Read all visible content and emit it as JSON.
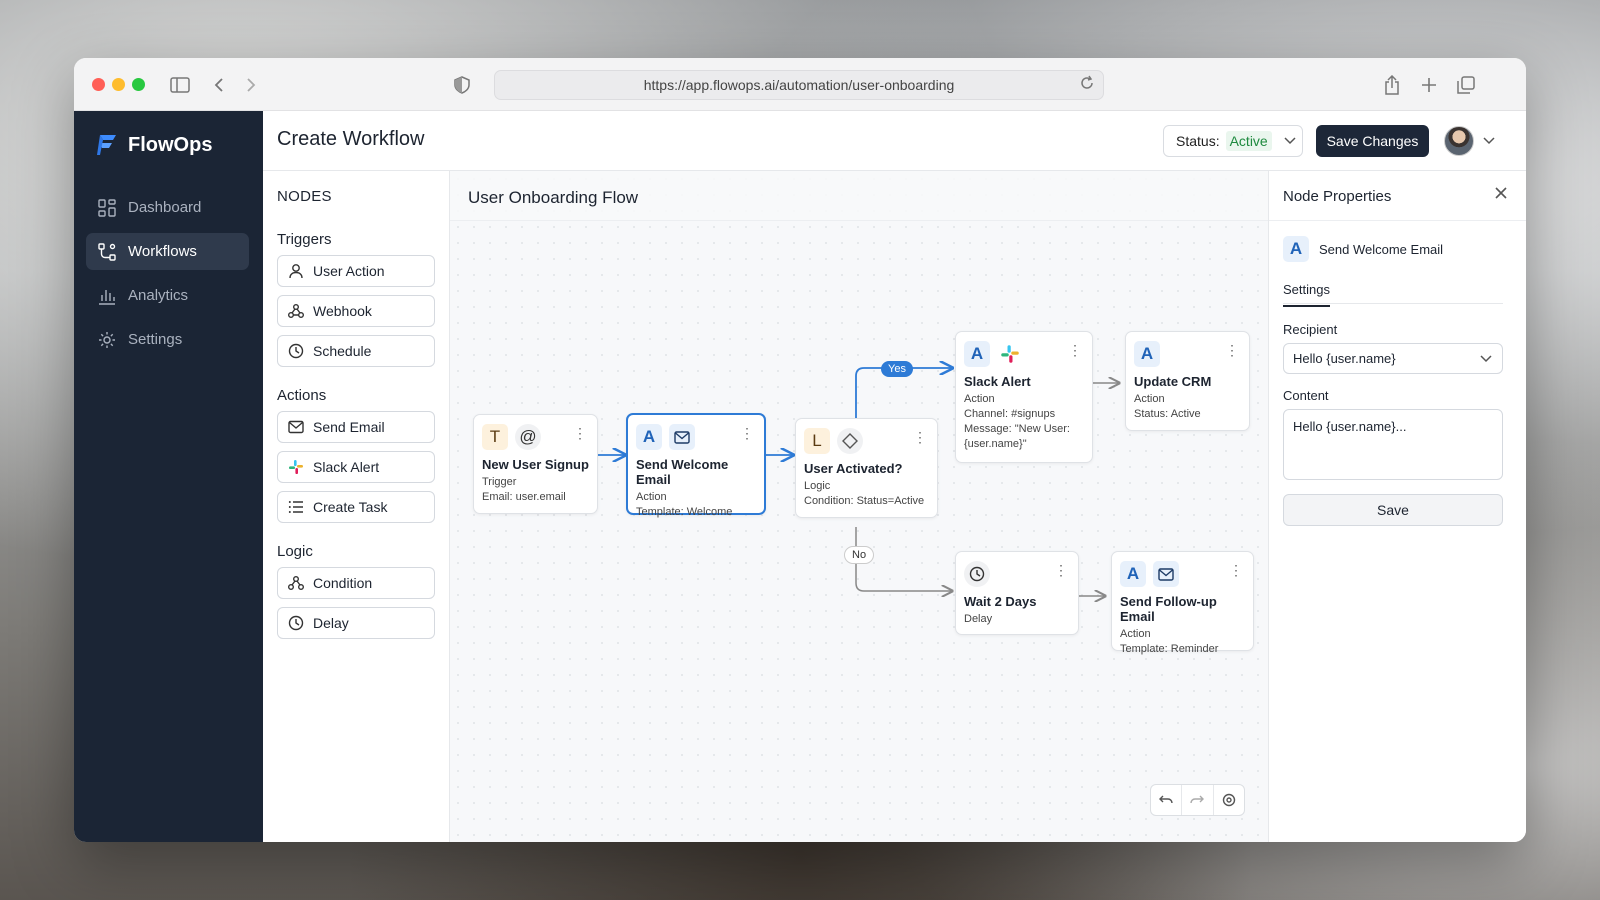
{
  "browser": {
    "url": "https://app.flowops.ai/automation/user-onboarding",
    "traffic_lights": [
      "#ff5f57",
      "#febc2e",
      "#28c840"
    ]
  },
  "brand": {
    "name": "FlowOps",
    "color": "#3d8bfd"
  },
  "sidebar": {
    "items": [
      {
        "label": "Dashboard",
        "icon": "grid-icon"
      },
      {
        "label": "Workflows",
        "icon": "workflow-icon",
        "active": true
      },
      {
        "label": "Analytics",
        "icon": "bar-chart-icon"
      },
      {
        "label": "Settings",
        "icon": "gear-icon"
      }
    ]
  },
  "header": {
    "title": "Create Workflow",
    "status_label": "Status:",
    "status_value": "Active",
    "save_label": "Save Changes"
  },
  "palette": {
    "title": "NODES",
    "sections": [
      {
        "label": "Triggers",
        "items": [
          "User Action",
          "Webhook",
          "Schedule"
        ]
      },
      {
        "label": "Actions",
        "items": [
          "Send Email",
          "Slack Alert",
          "Create Task"
        ]
      },
      {
        "label": "Logic",
        "items": [
          "Condition",
          "Delay"
        ]
      }
    ]
  },
  "canvas": {
    "title": "User Onboarding Flow",
    "nodes": {
      "signup": {
        "badge": "T",
        "title": "New User Signup",
        "lines": [
          "Trigger",
          "Email: user.email"
        ]
      },
      "welcome": {
        "badge": "A",
        "title": "Send Welcome Email",
        "lines": [
          "Action",
          "Template: Welcome"
        ]
      },
      "activated": {
        "badge": "L",
        "title": "User Activated?",
        "lines": [
          "Logic",
          "Condition: Status=Active"
        ]
      },
      "slack": {
        "badge": "A",
        "title": "Slack Alert",
        "lines": [
          "Action",
          "Channel: #signups",
          "Message: \"New User:",
          "{user.name}\""
        ]
      },
      "crm": {
        "badge": "A",
        "title": "Update CRM",
        "lines": [
          "Action",
          "Status: Active"
        ]
      },
      "wait": {
        "title": "Wait 2 Days",
        "lines": [
          "Delay"
        ]
      },
      "followup": {
        "badge": "A",
        "title": "Send Follow-up Email",
        "lines": [
          "Action",
          "Template: Reminder"
        ]
      }
    },
    "edge_labels": {
      "yes": "Yes",
      "no": "No"
    }
  },
  "properties": {
    "title": "Node Properties",
    "node_badge": "A",
    "node_name": "Send Welcome Email",
    "tab": "Settings",
    "recipient_label": "Recipient",
    "recipient_value": "Hello {user.name}",
    "content_label": "Content",
    "content_value": "Hello {user.name}...",
    "save_label": "Save"
  },
  "colors": {
    "accent": "#2e7bd6",
    "sidebar": "#1b2535",
    "active_status": "#1e8a3f"
  }
}
